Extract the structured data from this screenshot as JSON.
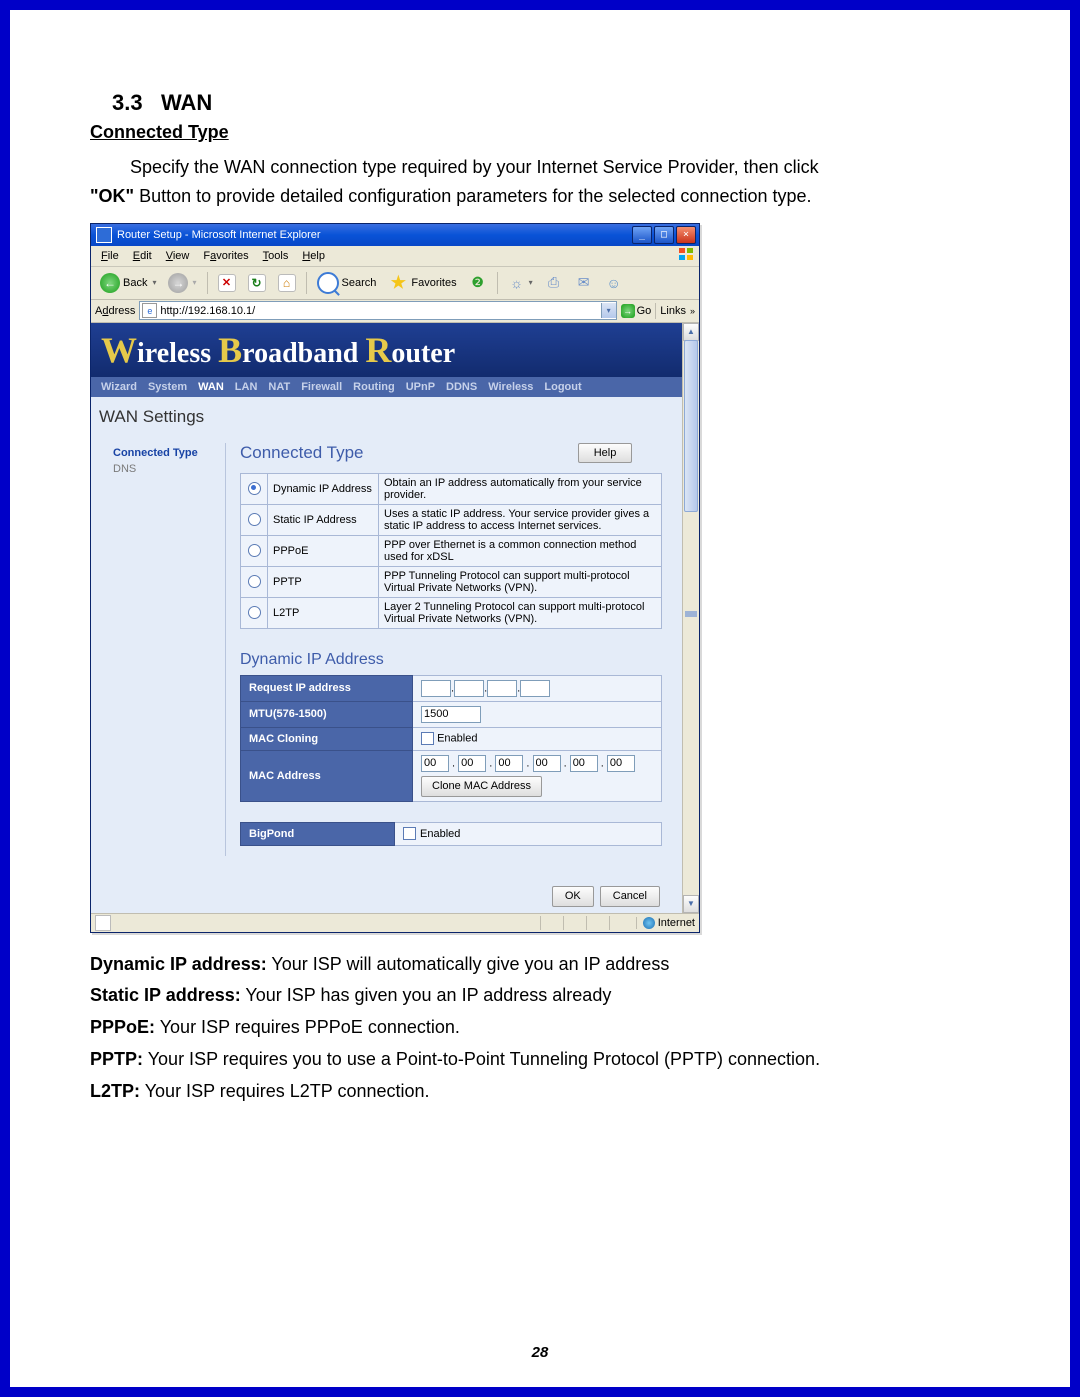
{
  "doc": {
    "section_num": "3.3",
    "section_title": "WAN",
    "subheading": "Connected Type",
    "intro_indent": "Specify the WAN connection type required by your Internet Service Provider, then click",
    "intro_line2_bold": "\"OK\"",
    "intro_line2_rest": " Button to provide detailed configuration parameters for the selected connection type.",
    "page_number": "28",
    "defs": {
      "dyn_b": "Dynamic IP address:",
      "dyn_t": " Your ISP will automatically give you an IP address",
      "stat_b": "Static IP address:",
      "stat_t": " Your ISP has given you an IP address already",
      "pppoe_b": "PPPoE:",
      "pppoe_t": " Your ISP requires PPPoE connection.",
      "pptp_b": "PPTP:",
      "pptp_t": " Your ISP requires you to use a Point-to-Point Tunneling Protocol (PPTP) connection.",
      "l2tp_b": "L2TP:",
      "l2tp_t": " Your ISP requires L2TP connection."
    }
  },
  "ie": {
    "title": "Router Setup - Microsoft Internet Explorer",
    "menus": {
      "file": "File",
      "edit": "Edit",
      "view": "View",
      "favorites": "Favorites",
      "tools": "Tools",
      "help": "Help"
    },
    "toolbar": {
      "back": "Back",
      "search": "Search",
      "favorites": "Favorites"
    },
    "address_label": "Address",
    "address_value": "http://192.168.10.1/",
    "go": "Go",
    "links": "Links",
    "status_zone": "Internet"
  },
  "router": {
    "banner": {
      "w": "W",
      "t1": "ireless ",
      "b": "B",
      "t2": "roadband ",
      "r": "R",
      "t3": "outer"
    },
    "nav": [
      "Wizard",
      "System",
      "WAN",
      "LAN",
      "NAT",
      "Firewall",
      "Routing",
      "UPnP",
      "DDNS",
      "Wireless",
      "Logout"
    ],
    "nav_active": "WAN",
    "page_heading": "WAN Settings",
    "sidenav": {
      "active": "Connected Type",
      "other": "DNS"
    },
    "sect_title": "Connected Type",
    "help": "Help",
    "options": [
      {
        "label": "Dynamic IP Address",
        "desc": "Obtain an IP address automatically from your service provider.",
        "selected": true
      },
      {
        "label": "Static IP Address",
        "desc": "Uses a static IP address. Your service provider gives a static IP address to access Internet services.",
        "selected": false
      },
      {
        "label": "PPPoE",
        "desc": "PPP over Ethernet is a common connection method used for xDSL",
        "selected": false
      },
      {
        "label": "PPTP",
        "desc": "PPP Tunneling Protocol can support multi-protocol Virtual Private Networks (VPN).",
        "selected": false
      },
      {
        "label": "L2TP",
        "desc": "Layer 2 Tunneling Protocol can support multi-protocol Virtual Private Networks (VPN).",
        "selected": false
      }
    ],
    "sect2": "Dynamic IP Address",
    "form": {
      "reqip": "Request IP address",
      "mtu_label": "MTU(576-1500)",
      "mtu_val": "1500",
      "macclone": "MAC Cloning",
      "enabled": "Enabled",
      "macaddr": "MAC Address",
      "mac_part": "00",
      "clone_btn": "Clone MAC Address",
      "bigpond": "BigPond"
    },
    "buttons": {
      "ok": "OK",
      "cancel": "Cancel"
    }
  }
}
